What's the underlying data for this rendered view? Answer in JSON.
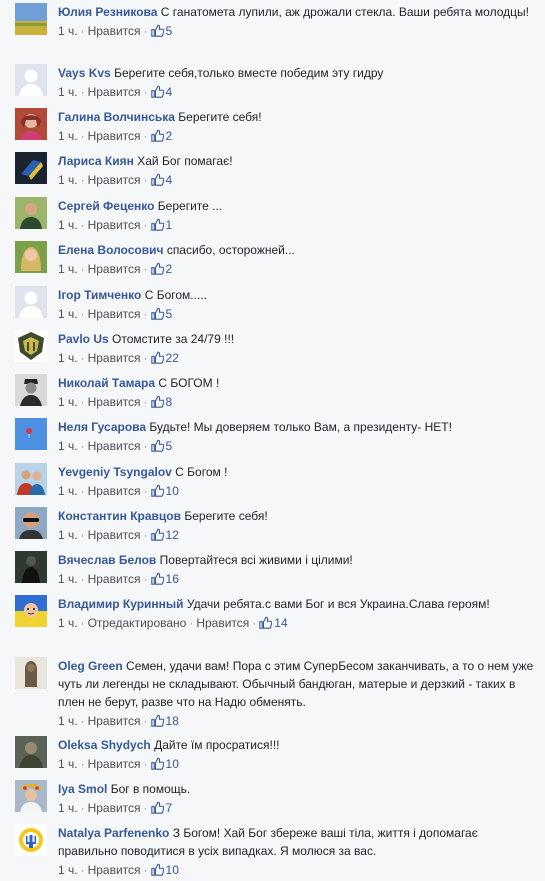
{
  "like_label": "Нравится",
  "edited_label": "Отредактировано",
  "icons": {
    "like": "thumbs-up-icon"
  },
  "colors": {
    "author": "#365899",
    "meta": "#90949c",
    "background": "#f6f7f9"
  },
  "comments": [
    {
      "author": "Юлия Резникова",
      "text": "С ганатомета лупили, аж дрожали стекла. Ваши ребята молодцы!",
      "time": "1 ч.",
      "likes": "5",
      "avatar": "landscape"
    },
    {
      "author": "Vays Kvs",
      "text": "Берегите себя,только вместе победим эту гидру",
      "time": "1 ч.",
      "likes": "4",
      "avatar": "default"
    },
    {
      "author": "Галина Волчинська",
      "text": "Берегите себя!",
      "time": "1 ч.",
      "likes": "2",
      "avatar": "woman-red"
    },
    {
      "author": "Лариса Киян",
      "text": "Хай Бог помагає!",
      "time": "1 ч.",
      "likes": "4",
      "avatar": "flag-dark"
    },
    {
      "author": "Сергей Феценко",
      "text": "Берегите ...",
      "time": "1 ч.",
      "likes": "1",
      "avatar": "man-green"
    },
    {
      "author": "Елена Волосович",
      "text": "спасибо, осторожней...",
      "time": "1 ч.",
      "likes": "2",
      "avatar": "woman-blonde"
    },
    {
      "author": "Ігор Тимченко",
      "text": "С Богом.....",
      "time": "1 ч.",
      "likes": "5",
      "avatar": "default"
    },
    {
      "author": "Pavlo Us",
      "text": "Отомстите за 24/79 !!!",
      "time": "1 ч.",
      "likes": "22",
      "avatar": "emblem"
    },
    {
      "author": "Николай Тамара",
      "text": "С БОГОМ !",
      "time": "1 ч.",
      "likes": "8",
      "avatar": "man-bw"
    },
    {
      "author": "Неля Гусарова",
      "text": "Будьте! Мы доверяем только Вам, а президенту- НЕТ!",
      "time": "1 ч.",
      "likes": "5",
      "avatar": "sky-balloon"
    },
    {
      "author": "Yevgeniy Tsyngalov",
      "text": "С Богом !",
      "time": "1 ч.",
      "likes": "10",
      "avatar": "couple"
    },
    {
      "author": "Константин Кравцов",
      "text": "Берегите себя!",
      "time": "1 ч.",
      "likes": "12",
      "avatar": "man-glasses"
    },
    {
      "author": "Вячеслав Белов",
      "text": "Повертайтеся всі живими і цілими!",
      "time": "1 ч.",
      "likes": "16",
      "avatar": "dark-figure"
    },
    {
      "author": "Владимир Куринный",
      "text": "Удачи ребята.с вами Бог и вся Украина.Слава героям!",
      "time": "1 ч.",
      "likes": "14",
      "edited": true,
      "avatar": "ua-cartoon"
    },
    {
      "author": "Oleg Green",
      "text": "Семен, удачи вам! Пора с этим СуперБесом заканчивать, а то о нем уже чуть ли легенды не складывают. Обычный бандюган, матерые и дерзкий - таких в плен не берут, разве что на Надю обменять.",
      "time": "1 ч.",
      "likes": "18",
      "avatar": "statue"
    },
    {
      "author": "Oleksa Shydych",
      "text": "Дайте їм просратися!!!",
      "time": "1 ч.",
      "likes": "10",
      "avatar": "soldier"
    },
    {
      "author": "Iya Smol",
      "text": "Бог в помощь.",
      "time": "1 ч.",
      "likes": "7",
      "avatar": "woman-wreath"
    },
    {
      "author": "Natalya Parfenenko",
      "text": "З Богом! Хай Бог збереже ваші тіла, життя і допомагає правильно поводитися в усіх випадках. Я молюся за вас.",
      "time": "1 ч.",
      "likes": "10",
      "avatar": "trident-sun"
    }
  ]
}
